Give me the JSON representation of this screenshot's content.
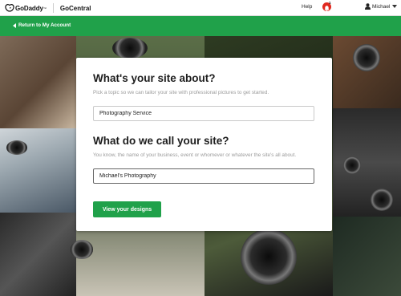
{
  "topbar": {
    "brand": "GoDaddy",
    "brand_tm": "™",
    "product": "GoCentral",
    "help_label": "Help",
    "notification_count": "1",
    "user_name": "Michael"
  },
  "nav": {
    "return_label": "Return to My Account"
  },
  "form": {
    "about_heading": "What's your site about?",
    "about_hint": "Pick a topic so we can tailor your site with professional pictures to get started.",
    "about_value": "Photography Service",
    "name_heading": "What do we call your site?",
    "name_hint": "You know, the name of your business, event or whomever or whatever the site's all about.",
    "name_value": "Michael's Photography",
    "submit_label": "View your designs"
  },
  "colors": {
    "accent_green": "#20a14a",
    "notification_red": "#e0281f"
  }
}
